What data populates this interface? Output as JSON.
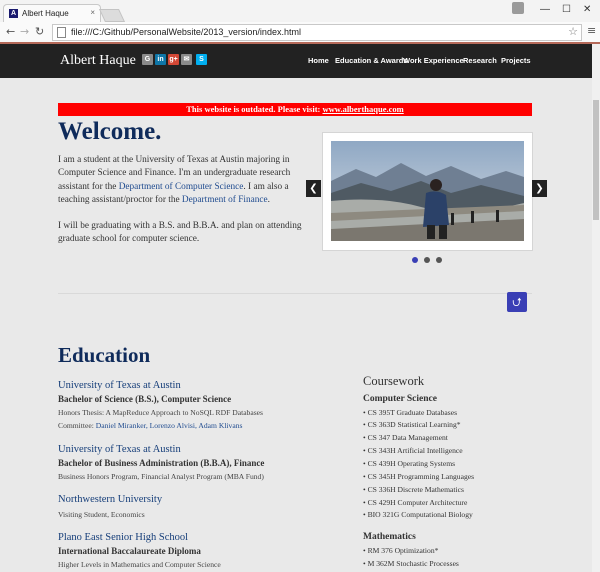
{
  "browser": {
    "tab_title": "Albert Haque",
    "tab_close": "×",
    "favicon_letter": "A",
    "url": "file:///C:/Github/PersonalWebsite/2013_version/index.html",
    "window_controls": [
      "—",
      "☐",
      "✕"
    ],
    "nav_icons": [
      "back-icon",
      "forward-icon",
      "reload-icon"
    ]
  },
  "navbar": {
    "brand": "Albert Haque",
    "social": [
      {
        "label": "G",
        "icon": "github-icon",
        "color": "#8a8a8a"
      },
      {
        "label": "in",
        "icon": "linkedin-icon",
        "color": "#0e76a8"
      },
      {
        "label": "g+",
        "icon": "googleplus-icon",
        "color": "#d34836"
      },
      {
        "label": "✉",
        "icon": "email-icon",
        "color": "#8a8a8a"
      },
      {
        "label": "S",
        "icon": "skype-icon",
        "color": "#00aff0"
      }
    ],
    "links": [
      "Home",
      "Education & Awards",
      "Work Experience",
      "Research",
      "Projects"
    ]
  },
  "banner": {
    "text": "This website is outdated. Please visit: ",
    "link": "www.alberthaque.com",
    "color": "#ff0000"
  },
  "welcome": {
    "title": "Welcome.",
    "p1_a": "I am a student at the University of Texas at Austin majoring in Computer Science and Finance. I'm an undergraduate research assistant for the ",
    "p1_link1": "Department of Computer Science",
    "p1_b": ". I am also a teaching assistant/proctor for the ",
    "p1_link2": "Department of Finance",
    "p1_c": ".",
    "p2": "I will be graduating with a B.S. and B.B.A. and plan on attending graduate school for computer science."
  },
  "carousel": {
    "prev": "❮",
    "next": "❯",
    "active_slide": 1,
    "slide_count": 3
  },
  "education": {
    "heading": "Education",
    "schools": [
      {
        "name": "University of Texas at Austin",
        "degree": "Bachelor of Science (B.S.), Computer Science",
        "details": [
          "Honors Thesis: A MapReduce Approach to NoSQL RDF Databases"
        ],
        "committee_label": "Committee: ",
        "committee": "Daniel Miranker, Lorenzo Alvisi, Adam Klivans"
      },
      {
        "name": "University of Texas at Austin",
        "degree": "Bachelor of Business Administration (B.B.A), Finance",
        "details": [
          "Business Honors Program, Financial Analyst Program (MBA Fund)"
        ]
      },
      {
        "name": "Northwestern University",
        "degree": "",
        "details": [
          "Visiting Student, Economics"
        ]
      },
      {
        "name": "Plano East Senior High School",
        "degree": "International Baccalaureate Diploma",
        "details": [
          "Higher Levels in Mathematics and Computer Science"
        ]
      }
    ]
  },
  "coursework": {
    "heading": "Coursework",
    "cs_heading": "Computer Science",
    "cs_courses": [
      "CS 395T Graduate Databases",
      "CS 363D Statistical Learning*",
      "CS 347 Data Management",
      "CS 343H Artificial Intelligence",
      "CS 439H Operating Systems",
      "CS 345H Programming Languages",
      "CS 336H Discrete Mathematics",
      "CS 429H Computer Architecture",
      "BIO 321G Computational Biology"
    ],
    "math_heading": "Mathematics",
    "math_courses": [
      "RM 376 Optimization*",
      "M 362M Stochastic Processes"
    ]
  },
  "colors": {
    "heading": "#0f2b5b",
    "link": "#1f4b8f",
    "navbar": "#222222",
    "scroll_button": "#3a3fb5"
  }
}
